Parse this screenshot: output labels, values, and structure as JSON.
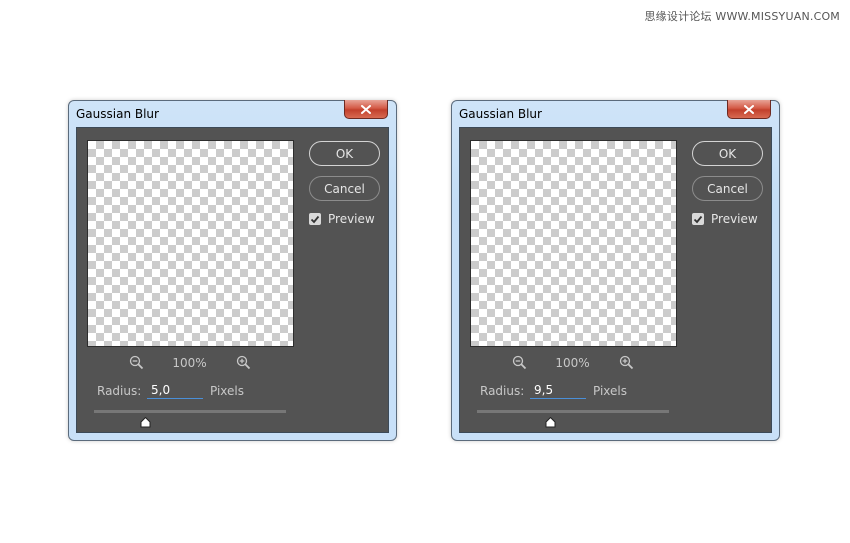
{
  "watermark": "思缘设计论坛 WWW.MISSYUAN.COM",
  "dialogs": [
    {
      "title": "Gaussian Blur",
      "ok_label": "OK",
      "cancel_label": "Cancel",
      "preview_label": "Preview",
      "preview_checked": true,
      "zoom_level": "100%",
      "radius_label": "Radius:",
      "radius_value": "5,0",
      "units_label": "Pixels",
      "slider_value_fraction": 0.27
    },
    {
      "title": "Gaussian Blur",
      "ok_label": "OK",
      "cancel_label": "Cancel",
      "preview_label": "Preview",
      "preview_checked": true,
      "zoom_level": "100%",
      "radius_label": "Radius:",
      "radius_value": "9,5",
      "units_label": "Pixels",
      "slider_value_fraction": 0.385
    }
  ],
  "icons": {
    "close": "close-icon",
    "zoom_out": "zoom-out-icon",
    "zoom_in": "zoom-in-icon",
    "check": "checkmark-icon",
    "slider_thumb": "slider-thumb-icon"
  }
}
